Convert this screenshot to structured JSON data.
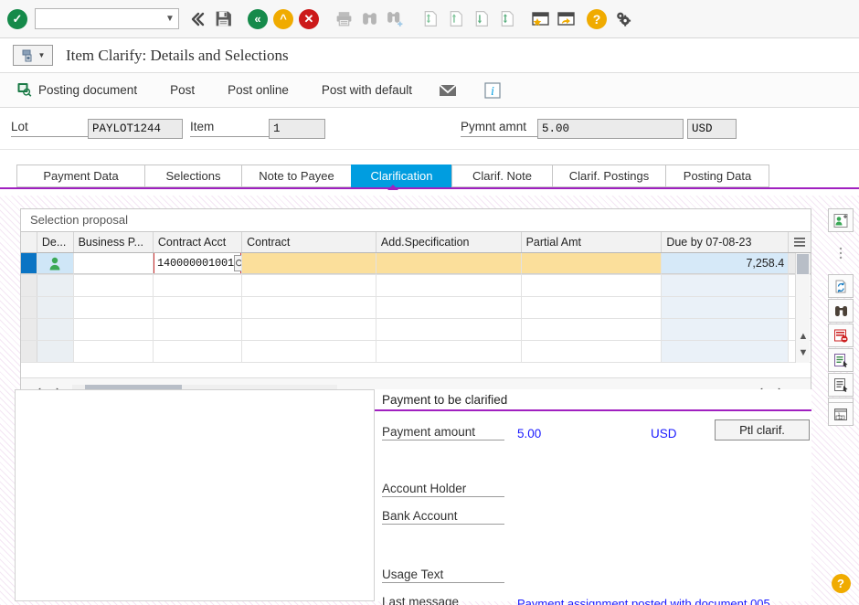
{
  "toolbar": {
    "ok_icon": "green-check-icon",
    "command_field_value": "",
    "command_field_placeholder": "",
    "icons": [
      {
        "name": "back-icon",
        "glyph": "«"
      },
      {
        "name": "save-icon",
        "glyph": "save"
      },
      {
        "name": "back-green-icon",
        "glyph": "«"
      },
      {
        "name": "exit-orange-icon",
        "glyph": "»"
      },
      {
        "name": "cancel-red-icon",
        "glyph": "✕"
      },
      {
        "name": "print-icon",
        "glyph": "print"
      },
      {
        "name": "find-icon",
        "glyph": "find"
      },
      {
        "name": "find-next-icon",
        "glyph": "find+"
      },
      {
        "name": "first-page-icon",
        "glyph": "page"
      },
      {
        "name": "previous-page-icon",
        "glyph": "page"
      },
      {
        "name": "next-page-icon",
        "glyph": "page"
      },
      {
        "name": "last-page-icon",
        "glyph": "page"
      },
      {
        "name": "create-favorite-icon",
        "glyph": "win"
      },
      {
        "name": "create-shortcut-icon",
        "glyph": "win"
      },
      {
        "name": "help-icon",
        "glyph": "?"
      },
      {
        "name": "customize-local-layout-icon",
        "glyph": "gear"
      }
    ]
  },
  "titlebar": {
    "menu_button_name": "system-menu-button",
    "title": "Item Clarify: Details and Selections"
  },
  "functionbar": {
    "items": [
      {
        "label": "Posting document",
        "icon": "posting-document-icon"
      },
      {
        "label": "Post",
        "icon": ""
      },
      {
        "label": "Post online",
        "icon": ""
      },
      {
        "label": "Post with default",
        "icon": ""
      }
    ],
    "mail_icon": "envelope-icon",
    "info_icon": "info-icon"
  },
  "header": {
    "lot_label": "Lot",
    "lot_value": "PAYLOT1244",
    "item_label": "Item",
    "item_value": "1",
    "pymnt_label": "Pymnt amnt",
    "pymnt_value": "5.00",
    "currency_value": "USD"
  },
  "tabs": [
    {
      "label": "Payment Data",
      "active": false
    },
    {
      "label": "Selections",
      "active": false
    },
    {
      "label": "Note to Payee",
      "active": false
    },
    {
      "label": "Clarification",
      "active": true
    },
    {
      "label": "Clarif. Note",
      "active": false
    },
    {
      "label": "Clarif. Postings",
      "active": false
    },
    {
      "label": "Posting Data",
      "active": false
    }
  ],
  "table": {
    "caption": "Selection proposal",
    "columns": [
      "De...",
      "Business P...",
      "Contract Acct",
      "Contract",
      "Add.Specification",
      "Partial Amt",
      "Due by 07-08-23"
    ],
    "menu_icon": "table-settings-icon",
    "rows": [
      {
        "status_icon": "business-partner-icon",
        "business_partner": "",
        "contract_account": "140000001001",
        "contract": "",
        "add_specification": "",
        "partial_amt": "",
        "due_by": "7,258.4"
      },
      {
        "status_icon": "",
        "business_partner": "",
        "contract_account": "",
        "contract": "",
        "add_specification": "",
        "partial_amt": "",
        "due_by": ""
      },
      {
        "status_icon": "",
        "business_partner": "",
        "contract_account": "",
        "contract": "",
        "add_specification": "",
        "partial_amt": "",
        "due_by": ""
      },
      {
        "status_icon": "",
        "business_partner": "",
        "contract_account": "",
        "contract": "",
        "add_specification": "",
        "partial_amt": "",
        "due_by": ""
      },
      {
        "status_icon": "",
        "business_partner": "",
        "contract_account": "",
        "contract": "",
        "add_specification": "",
        "partial_amt": "",
        "due_by": ""
      }
    ],
    "f4_icon": "value-help-icon",
    "hscroll_thumb_glyph": "⋯",
    "scroll_left_icon": "chevron-left-icon",
    "scroll_right_icon": "chevron-right-icon",
    "scroll_up_icon": "chevron-up-icon",
    "scroll_down_icon": "chevron-down-icon"
  },
  "sidetools": [
    {
      "name": "assign-partner-icon"
    },
    {
      "name": "refresh-icon"
    },
    {
      "name": "find-items-icon"
    },
    {
      "name": "delete-item-icon"
    },
    {
      "name": "details-icon"
    },
    {
      "name": "list-details-icon"
    },
    {
      "name": "execute-icon"
    }
  ],
  "detail": {
    "title": "Payment to be clarified",
    "payment_amount_label": "Payment amount",
    "payment_amount_value": "5.00",
    "currency": "USD",
    "partial_clarification_button": "Ptl clarif.",
    "account_holder_label": "Account Holder",
    "account_holder_value": "",
    "bank_account_label": "Bank Account",
    "bank_account_value": "",
    "usage_text_label": "Usage Text",
    "usage_text_value": "",
    "last_message_label": "Last message",
    "last_message_value": "Payment assignment posted with document 005…"
  },
  "right_tools": {
    "calendar_icon": "calendar-icon",
    "help_icon": "help-icon"
  },
  "colors": {
    "accent_purple": "#a020c0",
    "tab_active_blue": "#009de0",
    "row_amber": "#fbdf9b",
    "row_blue": "#d6e9f8",
    "link_blue": "#1a1aff"
  }
}
